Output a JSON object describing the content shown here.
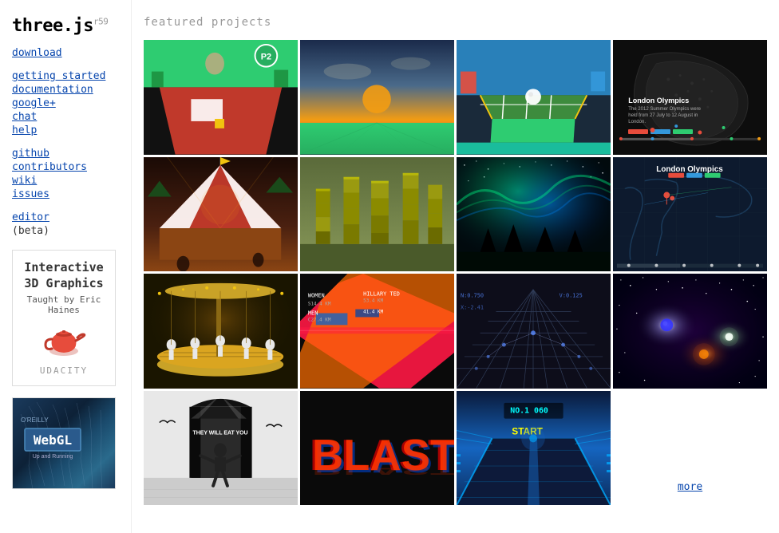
{
  "sidebar": {
    "title": "three.js",
    "version": "r59",
    "links": {
      "download": "download",
      "getting_started": "getting started",
      "documentation": "documentation",
      "google_plus": "google+",
      "chat": "chat",
      "help": "help",
      "github": "github",
      "contributors": "contributors",
      "wiki": "wiki",
      "issues": "issues",
      "editor": "editor",
      "editor_beta": "(beta)"
    }
  },
  "main": {
    "section_title": "featured projects",
    "more_label": "more",
    "grid_cells": [
      {
        "id": 1,
        "label": "Game table scene"
      },
      {
        "id": 2,
        "label": "Sunset landscape"
      },
      {
        "id": 3,
        "label": "3D game board"
      },
      {
        "id": 4,
        "label": "Black sculpture"
      },
      {
        "id": 5,
        "label": "Circus night scene"
      },
      {
        "id": 6,
        "label": "Voxel forest"
      },
      {
        "id": 7,
        "label": "Aurora borealis"
      },
      {
        "id": 8,
        "label": "London Olympics map"
      },
      {
        "id": 9,
        "label": "Carousel dancers"
      },
      {
        "id": 10,
        "label": "Abstract typography"
      },
      {
        "id": 11,
        "label": "3D grid visualization"
      },
      {
        "id": 12,
        "label": "Space scene"
      },
      {
        "id": 13,
        "label": "Dark figure scene"
      },
      {
        "id": 14,
        "label": "BLAST text"
      },
      {
        "id": 15,
        "label": "Futuristic tunnel"
      },
      {
        "id": 16,
        "label": "more"
      }
    ]
  },
  "ad": {
    "title": "Interactive\n3D Graphics",
    "subtitle": "Taught by Eric Haines",
    "brand": "UDACITY"
  },
  "book": {
    "title": "WebGL",
    "subtitle": "Up and Running",
    "publisher": "O'REILLY"
  }
}
